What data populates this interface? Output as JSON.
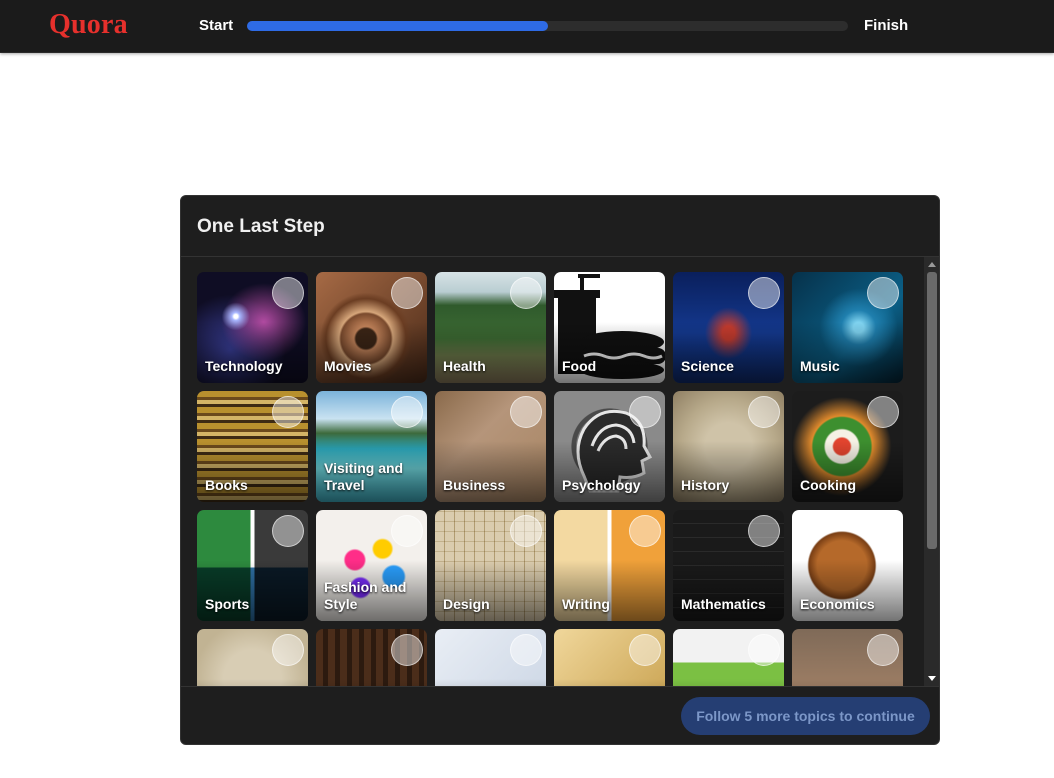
{
  "header": {
    "logo_text": "Quora",
    "progress_start_label": "Start",
    "progress_end_label": "Finish",
    "progress_fraction": 0.5
  },
  "modal": {
    "title": "One Last Step",
    "topics": [
      {
        "label": "Technology"
      },
      {
        "label": "Movies"
      },
      {
        "label": "Health"
      },
      {
        "label": "Food"
      },
      {
        "label": "Science"
      },
      {
        "label": "Music"
      },
      {
        "label": "Books"
      },
      {
        "label": "Visiting and Travel"
      },
      {
        "label": "Business"
      },
      {
        "label": "Psychology"
      },
      {
        "label": "History"
      },
      {
        "label": "Cooking"
      },
      {
        "label": "Sports"
      },
      {
        "label": "Fashion and Style"
      },
      {
        "label": "Design"
      },
      {
        "label": "Writing"
      },
      {
        "label": "Mathematics"
      },
      {
        "label": "Economics"
      },
      {
        "label": ""
      },
      {
        "label": ""
      },
      {
        "label": ""
      },
      {
        "label": ""
      },
      {
        "label": ""
      },
      {
        "label": ""
      }
    ],
    "continue_button_label": "Follow 5 more topics to continue"
  },
  "colors": {
    "brand_red": "#e6302c",
    "progress_blue": "#2e6be5",
    "button_disabled_bg": "#253e73"
  }
}
